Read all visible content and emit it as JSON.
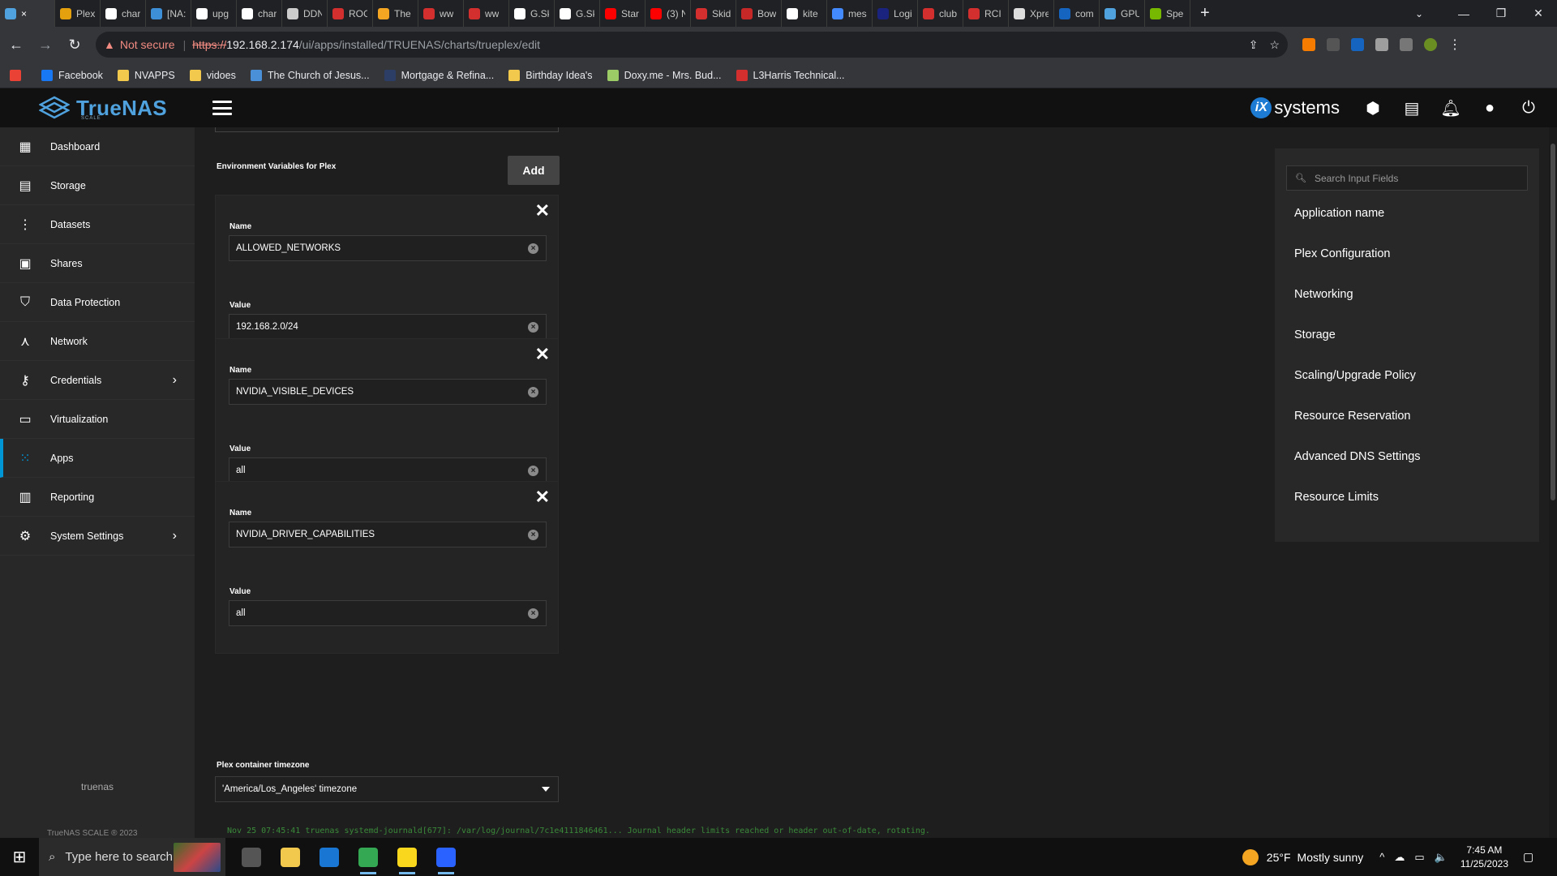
{
  "browser": {
    "tabs": [
      {
        "label": "×",
        "icon": "truenas-icon",
        "color": "#4fa2dd",
        "active": true
      },
      {
        "label": "Plex",
        "icon": "plex-icon",
        "color": "#e5a00d"
      },
      {
        "label": "char",
        "icon": "github-icon",
        "color": "#ffffff"
      },
      {
        "label": "[NA:",
        "icon": "docs-icon",
        "color": "#3d8fd8"
      },
      {
        "label": "upg",
        "icon": "github-icon",
        "color": "#ffffff"
      },
      {
        "label": "char",
        "icon": "github-icon",
        "color": "#ffffff"
      },
      {
        "label": "DDN",
        "icon": "web-icon",
        "color": "#cccccc"
      },
      {
        "label": "ROG",
        "icon": "rog-icon",
        "color": "#d32f2f"
      },
      {
        "label": "The",
        "icon": "hd-icon",
        "color": "#f4a522"
      },
      {
        "label": "ww",
        "icon": "g-icon",
        "color": "#d32f2f"
      },
      {
        "label": "ww",
        "icon": "g-icon",
        "color": "#d32f2f"
      },
      {
        "label": "G.Sk",
        "icon": "amazon-icon",
        "color": "#ffffff"
      },
      {
        "label": "G.Sk",
        "icon": "amazon-icon",
        "color": "#ffffff"
      },
      {
        "label": "Star",
        "icon": "youtube-icon",
        "color": "#ff0000"
      },
      {
        "label": "(3) N",
        "icon": "youtube-icon",
        "color": "#ff0000"
      },
      {
        "label": "Skid",
        "icon": "flag-icon",
        "color": "#d32f2f"
      },
      {
        "label": "Bow",
        "icon": "t-icon",
        "color": "#c62828"
      },
      {
        "label": "kite",
        "icon": "google-icon",
        "color": "#ffffff"
      },
      {
        "label": "mes",
        "icon": "chat-icon",
        "color": "#448aff"
      },
      {
        "label": "Logi",
        "icon": "cw-icon",
        "color": "#1a237e"
      },
      {
        "label": "club",
        "icon": "red-icon",
        "color": "#d32f2f"
      },
      {
        "label": "RCI",
        "icon": "red-icon",
        "color": "#d32f2f"
      },
      {
        "label": "Xpre",
        "icon": "x-icon",
        "color": "#dddddd"
      },
      {
        "label": "com",
        "icon": "u-icon",
        "color": "#1565c0"
      },
      {
        "label": "GPU",
        "icon": "truenas-icon",
        "color": "#4fa2dd"
      },
      {
        "label": "Spe",
        "icon": "nvidia-icon",
        "color": "#76b900"
      }
    ],
    "new_tab": "+",
    "window_buttons": [
      "—",
      "❐",
      "✕"
    ],
    "tab_search": "⌄",
    "nav": {
      "back": "←",
      "forward": "→",
      "reload": "↻"
    },
    "security_label": "Not secure",
    "url_scheme": "https://",
    "url_host": "192.168.2.174",
    "url_path": "/ui/apps/installed/TRUENAS/charts/trueplex/edit",
    "omnibox_icons": [
      "⇪",
      "☆"
    ],
    "bookmarks": [
      {
        "label": "",
        "icon": "gmail-icon",
        "color": "#ea4335"
      },
      {
        "label": "Facebook",
        "icon": "facebook-icon",
        "color": "#1877f2"
      },
      {
        "label": "NVAPPS",
        "icon": "folder-icon",
        "color": "#f2c94c"
      },
      {
        "label": "vidoes",
        "icon": "folder-icon",
        "color": "#f2c94c"
      },
      {
        "label": "The Church of Jesus...",
        "icon": "church-icon",
        "color": "#4a90d9"
      },
      {
        "label": "Mortgage & Refina...",
        "icon": "fm-icon",
        "color": "#2d3e66"
      },
      {
        "label": "Birthday Idea's",
        "icon": "folder-icon",
        "color": "#f2c94c"
      },
      {
        "label": "Doxy.me - Mrs. Bud...",
        "icon": "doxy-icon",
        "color": "#9ccc65"
      },
      {
        "label": "L3Harris Technical...",
        "icon": "l3harris-icon",
        "color": "#d32f2f"
      }
    ]
  },
  "app": {
    "brand": "TrueNAS",
    "brand_sub": "SCALE",
    "vendor_badge": "iX",
    "vendor": "systems",
    "sidebar": {
      "items": [
        {
          "label": "Dashboard",
          "icon": "dashboard-icon",
          "glyph": "▦"
        },
        {
          "label": "Storage",
          "icon": "storage-icon",
          "glyph": "▤"
        },
        {
          "label": "Datasets",
          "icon": "datasets-icon",
          "glyph": "⋮"
        },
        {
          "label": "Shares",
          "icon": "shares-icon",
          "glyph": "▣"
        },
        {
          "label": "Data Protection",
          "icon": "shield-icon",
          "glyph": "⛉"
        },
        {
          "label": "Network",
          "icon": "network-icon",
          "glyph": "⋏"
        },
        {
          "label": "Credentials",
          "icon": "key-icon",
          "glyph": "⚷",
          "chevron": "›"
        },
        {
          "label": "Virtualization",
          "icon": "laptop-icon",
          "glyph": "▭"
        },
        {
          "label": "Apps",
          "icon": "apps-icon",
          "glyph": "⁙",
          "active": true
        },
        {
          "label": "Reporting",
          "icon": "reporting-icon",
          "glyph": "▥"
        },
        {
          "label": "System Settings",
          "icon": "gear-icon",
          "glyph": "⚙",
          "chevron": "›"
        }
      ],
      "hostname": "truenas",
      "version": "TrueNAS SCALE ® 2023"
    },
    "form": {
      "env_header": "Environment Variables for Plex",
      "add_label": "Add",
      "name_label": "Name",
      "value_label": "Value",
      "env_vars": [
        {
          "name": "ALLOWED_NETWORKS",
          "value": "192.168.2.0/24"
        },
        {
          "name": "NVIDIA_VISIBLE_DEVICES",
          "value": "all"
        },
        {
          "name": "NVIDIA_DRIVER_CAPABILITIES",
          "value": "all"
        }
      ],
      "timezone_label": "Plex container timezone",
      "timezone_value": "'America/Los_Angeles' timezone"
    },
    "right_panel": {
      "search_placeholder": "Search Input Fields",
      "sections": [
        "Application name",
        "Plex Configuration",
        "Networking",
        "Storage",
        "Scaling/Upgrade Policy",
        "Resource Reservation",
        "Advanced DNS Settings",
        "Resource Limits"
      ]
    },
    "console_line": "Nov 25 07:45:41 truenas systemd-journald[677]: /var/log/journal/7c1e4111846461... Journal header limits reached or header out-of-date, rotating."
  },
  "taskbar": {
    "search_placeholder": "Type here to search",
    "weather_temp": "25°F",
    "weather_text": "Mostly sunny",
    "time": "7:45 AM",
    "date": "11/25/2023",
    "apps": [
      {
        "icon": "task-view-icon",
        "color": "#555555"
      },
      {
        "icon": "file-explorer-icon",
        "color": "#f2c94c"
      },
      {
        "icon": "mail-icon",
        "color": "#1976d2"
      },
      {
        "icon": "chrome-icon",
        "color": "#34a853",
        "running": true
      },
      {
        "icon": "sticky-notes-icon",
        "color": "#f9d71c",
        "running": true
      },
      {
        "icon": "remote-app-icon",
        "color": "#2962ff",
        "running": true
      }
    ],
    "tray_icons": [
      "^",
      "☁",
      "▭",
      "🔈"
    ],
    "notification": "▢"
  }
}
